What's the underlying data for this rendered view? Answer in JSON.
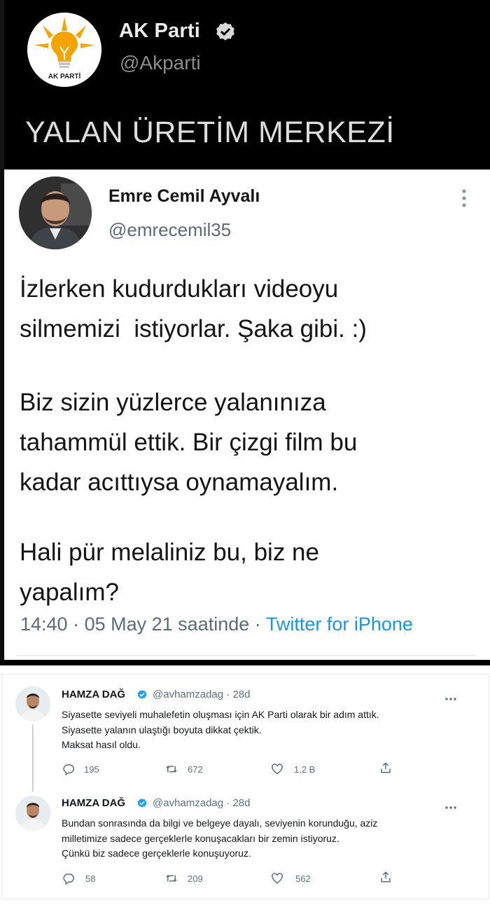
{
  "top_tweet": {
    "avatar_text": "AK PARTİ",
    "name": "AK Parti",
    "handle": "@Akparti",
    "slogan": "YALAN ÜRETİM MERKEZİ"
  },
  "main_tweet": {
    "name": "Emre Cemil Ayvalı",
    "handle": "@emrecemil35",
    "paragraphs": [
      [
        "İzlerken kudurdukları videoyu",
        "silmemizi  istiyorlar. Şaka gibi. :)"
      ],
      [
        "Biz sizin yüzlerce yalanınıza",
        "tahammül ettik. Bir çizgi film bu",
        "kadar acıttıysa oynamayalım."
      ],
      [
        "Hali pür melaliniz bu, biz ne",
        "yapalım?"
      ]
    ],
    "time": "14:40",
    "date": "05 May 21 saatinde",
    "separator": "·",
    "source": "Twitter for iPhone"
  },
  "thread": [
    {
      "name": "HAMZA DAĞ",
      "handle": "@avhamzadag",
      "age": "· 28d",
      "lines": [
        "Siyasette seviyeli muhalefetin oluşması için AK Parti olarak bir adım attık.",
        "Siyasette yalanın ulaştığı boyuta dikkat çektik.",
        "Maksat hasıl oldu."
      ],
      "replies": "195",
      "retweets": "672",
      "likes": "1,2 B"
    },
    {
      "name": "HAMZA DAĞ",
      "handle": "@avhamzadag",
      "age": "· 28d",
      "lines": [
        "Bundan sonrasında da bilgi ve belgeye dayalı, seviyenin korunduğu, aziz",
        "milletimize sadece gerçeklerle konuşacakları bir zemin istiyoruz.",
        "Çünkü biz sadece gerçeklerle konuşuyoruz."
      ],
      "replies": "58",
      "retweets": "209",
      "likes": "562"
    }
  ],
  "colors": {
    "verified": "#1da1f2",
    "link": "#1b95e0",
    "akp_orange": "#f5a300",
    "akp_blue": "#1e5aa8"
  },
  "icons": [
    "verified-badge-icon",
    "more-vertical-icon",
    "more-horizontal-icon",
    "reply-icon",
    "retweet-icon",
    "like-icon",
    "share-icon"
  ]
}
